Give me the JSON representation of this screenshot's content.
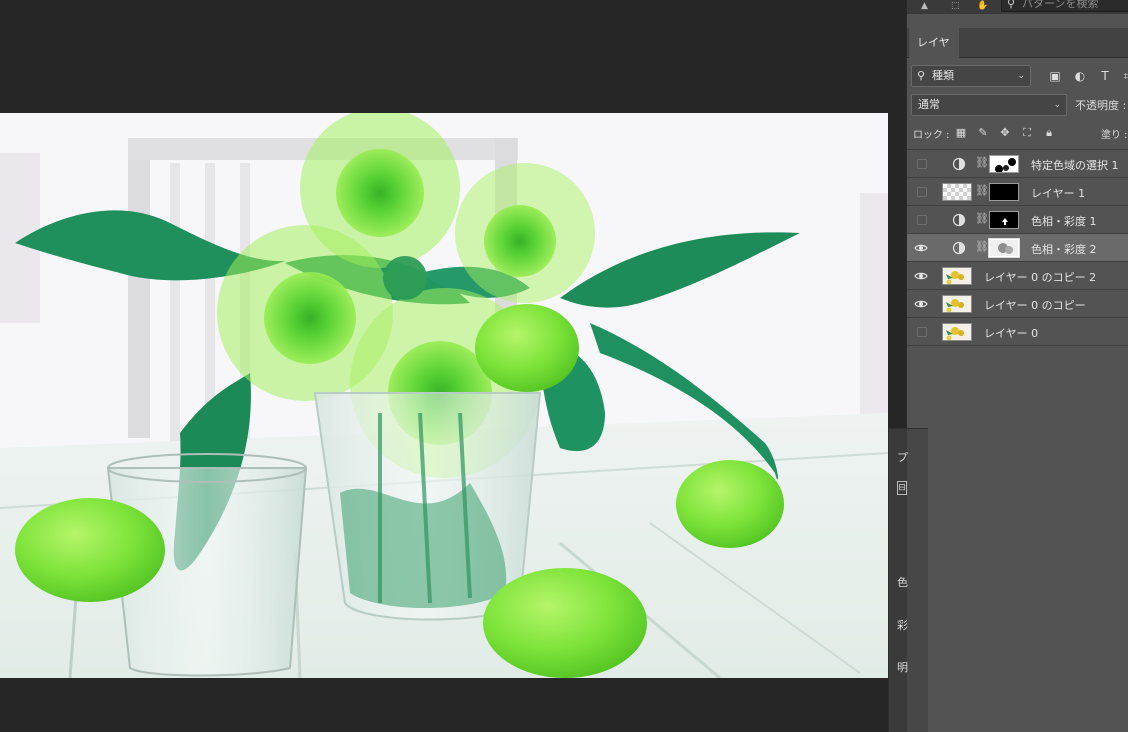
{
  "search": {
    "placeholder": "パターンを検索"
  },
  "panel": {
    "tab_label": "レイヤー",
    "filter_kind": "種類",
    "blend_mode": "通常",
    "opacity_label": "不透明度 :",
    "lock_label": "ロック :",
    "fill_label": "塗り :"
  },
  "layers": [
    {
      "name": "特定色域の選択 1",
      "visible": false,
      "type": "adjustment",
      "selected": false
    },
    {
      "name": "レイヤー 1",
      "visible": false,
      "type": "pixel-mask",
      "selected": false
    },
    {
      "name": "色相・彩度 1",
      "visible": false,
      "type": "adjustment",
      "selected": false
    },
    {
      "name": "色相・彩度 2",
      "visible": true,
      "type": "adjustment",
      "selected": true
    },
    {
      "name": "レイヤー 0 のコピー 2",
      "visible": true,
      "type": "image",
      "selected": false
    },
    {
      "name": "レイヤー 0 のコピー",
      "visible": true,
      "type": "image",
      "selected": false
    },
    {
      "name": "レイヤー 0",
      "visible": false,
      "type": "image",
      "selected": false
    }
  ],
  "props": {
    "chars": [
      "プ",
      "色",
      "彩",
      "明"
    ]
  },
  "icons": {
    "search": "search-icon",
    "eye": "eye-icon",
    "adjustment": "adjustment-layer-icon",
    "chain": "chain-link-icon",
    "lock": "lock-icon"
  },
  "colors": {
    "panel_bg": "#535353",
    "selected_row": "#6a6a6a",
    "canvas_bg": "#262626",
    "lime": "#7be83a",
    "leaf": "#1f8f5c"
  }
}
